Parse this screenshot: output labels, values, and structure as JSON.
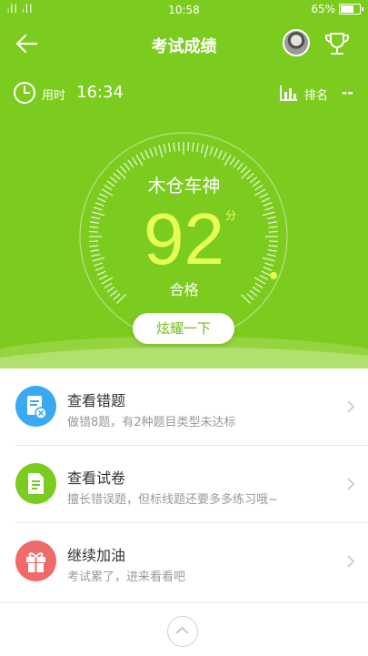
{
  "status_bar": {
    "signal": "ᵢll ᵢll",
    "time": "10:58",
    "battery": "65%"
  },
  "app_bar": {
    "title": "考试成绩"
  },
  "info": {
    "time_label": "用时",
    "time_value": "16:34",
    "rank_label": "排名",
    "rank_value": "--"
  },
  "score_card": {
    "name": "木仓车神",
    "score": "92",
    "unit": "分",
    "result": "合格",
    "share_button": "炫耀一下",
    "score_fraction": 0.92
  },
  "menu": [
    {
      "title": "查看错题",
      "subtitle": "做错8题，有2种题目类型未达标",
      "icon": "wrong-questions-icon",
      "color": "#3aa9f2"
    },
    {
      "title": "查看试卷",
      "subtitle": "擅长错误题，但标线题还要多多练习哦~",
      "icon": "paper-icon",
      "color": "#7ccc1f"
    },
    {
      "title": "继续加油",
      "subtitle": "考试累了，进来看看吧",
      "icon": "gift-icon",
      "color": "#f06a6a"
    }
  ],
  "colors": {
    "header": "#7ccc1f",
    "score": "#e6ff55"
  }
}
